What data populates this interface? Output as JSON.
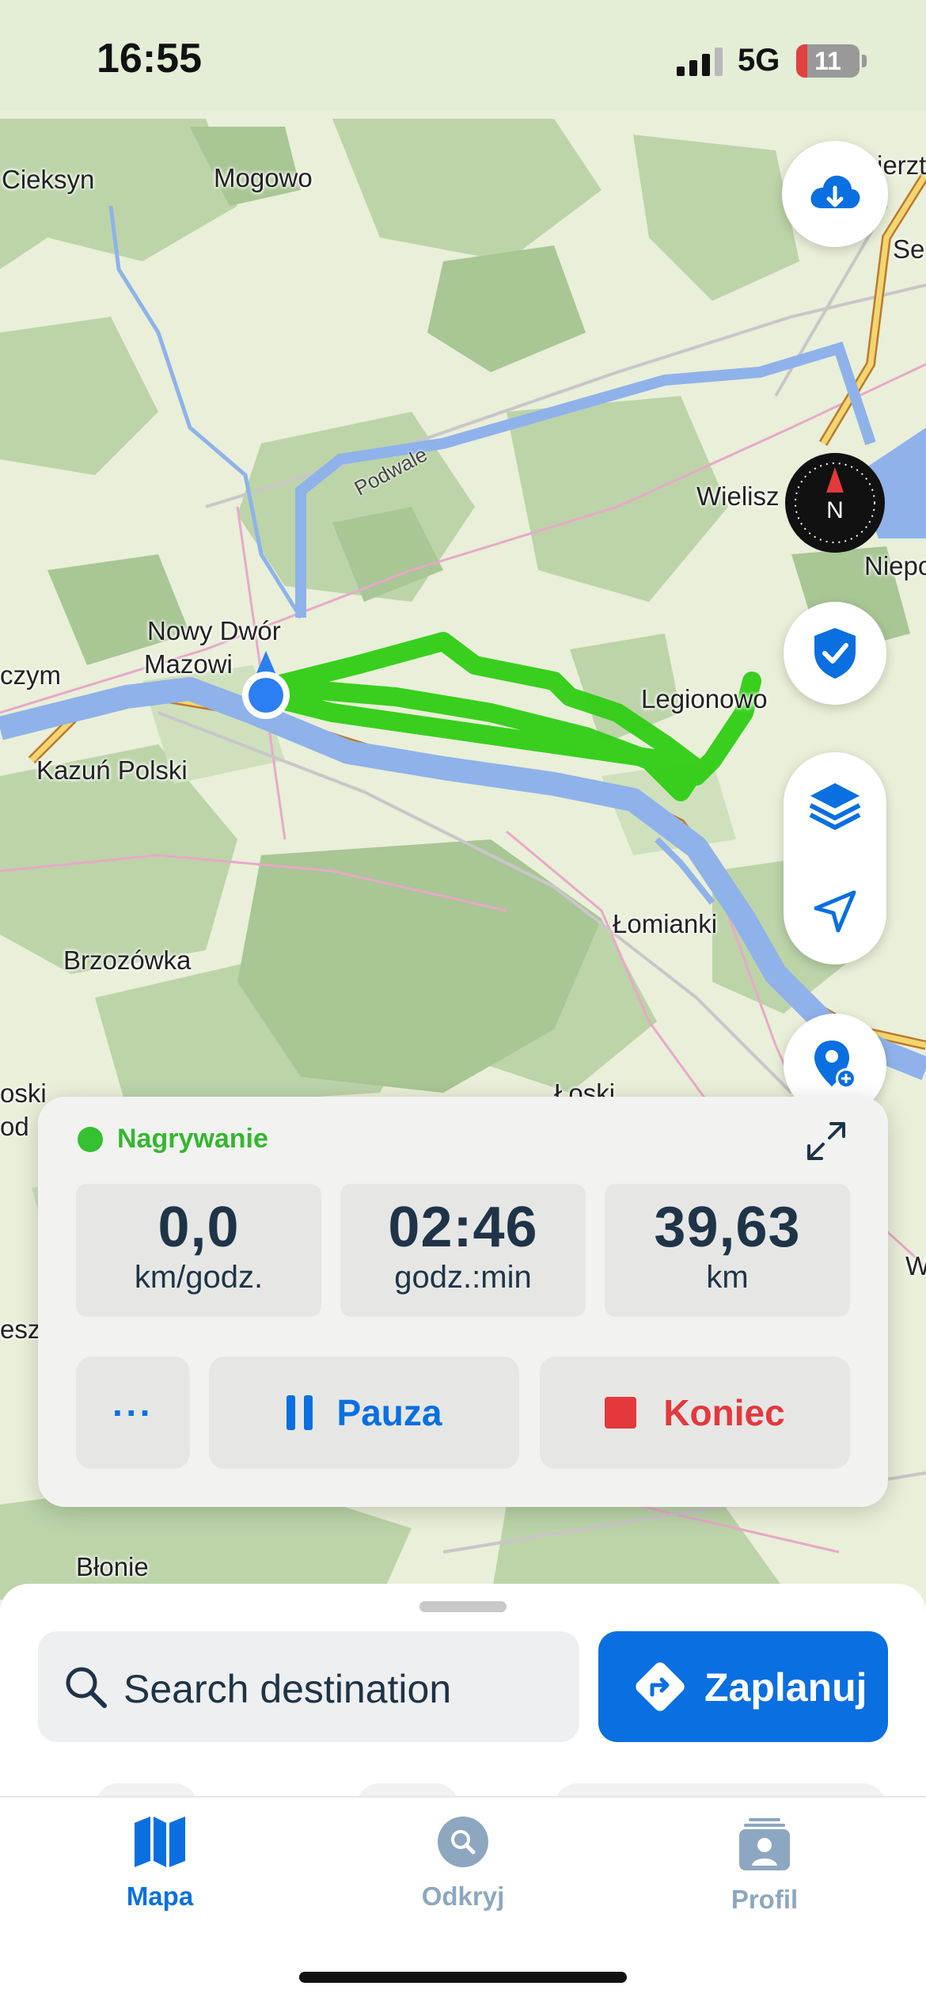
{
  "status_bar": {
    "time": "16:55",
    "network": "5G",
    "battery": "11"
  },
  "map": {
    "labels": {
      "cieksyn": "Cieksyn",
      "mogowo": "Mogowo",
      "nowy_dwor_1": "Nowy Dwór",
      "nowy_dwor_2": "Mazowi",
      "czym": "czym",
      "kazun": "Kazuń Polski",
      "brzozowka": "Brzozówka",
      "legionowo": "Legionowo",
      "wielisz": "Wielisz",
      "niepo": "Niepo",
      "lomianki": "Łomianki",
      "blonie": "Błonie",
      "podwale": "Podwale",
      "wierz": "ierzt",
      "se": "Se",
      "loski": "Łoski",
      "edge_w": "W",
      "edge_osk": "oski",
      "edge_od": "od",
      "edge_esz": "esz"
    },
    "colors": {
      "forest": "#b9d3a6",
      "forest_dark": "#a5c592",
      "meadow": "#e9efd8",
      "water": "#8fb2ea",
      "track": "#2fcc14",
      "road": "#f3d66f",
      "location": "#2b7ff2"
    }
  },
  "map_controls": {
    "download": "cloud-download-icon",
    "compass_letter": "N",
    "shield": "shield-check-icon",
    "layers": "layers-icon",
    "locate": "location-arrow-icon",
    "add_poi": "add-place-icon"
  },
  "recording": {
    "status": "Nagrywanie",
    "speed": {
      "value": "0,0",
      "unit": "km/godz."
    },
    "time": {
      "value": "02:46",
      "unit": "godz.:min"
    },
    "distance": {
      "value": "39,63",
      "unit": "km"
    },
    "more_label": "···",
    "pause_label": "Pauza",
    "end_label": "Koniec",
    "colors": {
      "pause": "#0a6fe0",
      "end": "#e3393d"
    }
  },
  "sheet": {
    "search_placeholder": "Search destination",
    "plan_label": "Zaplanuj"
  },
  "tabs": [
    {
      "label": "Mapa",
      "icon": "map-icon",
      "active": true
    },
    {
      "label": "Odkryj",
      "icon": "discover-search-icon",
      "active": false
    },
    {
      "label": "Profil",
      "icon": "profile-icon",
      "active": false
    }
  ]
}
